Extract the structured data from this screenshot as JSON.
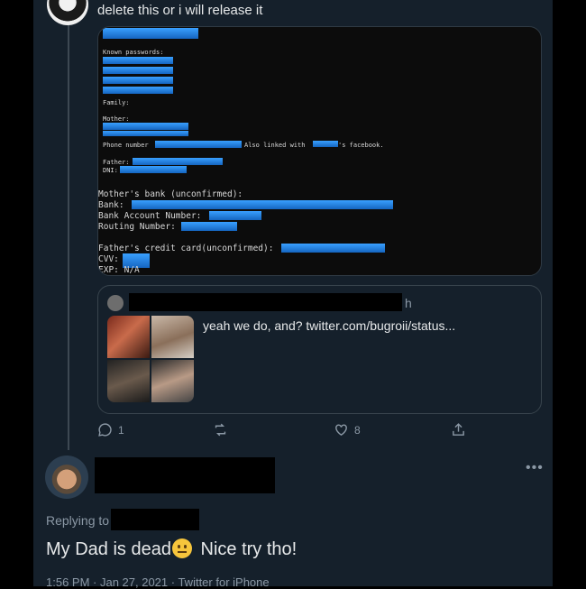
{
  "top_tweet": {
    "text": "delete this or i will release it"
  },
  "screenshot": {
    "known_passwords": "Known passwords:",
    "family": "Family:",
    "mother": "Mother:",
    "phone_number": "Phone number",
    "also_linked": "Also linked with",
    "facebook_suffix": "'s facebook.",
    "father": "Father:",
    "dni": "DNI:",
    "mothers_bank": "Mother's bank (unconfirmed):",
    "bank": "Bank:",
    "bank_account": "Bank Account Number:",
    "routing": "Routing Number:",
    "fathers_card": "Father's credit card(unconfirmed):",
    "cvv": "CVV:",
    "exp": "EXP: N/A"
  },
  "quote": {
    "handle_suffix": "h",
    "text": "yeah we do, and?  twitter.com/bugroii/status..."
  },
  "actions": {
    "reply_count": "1",
    "retweet_count": "",
    "like_count": "8"
  },
  "reply": {
    "replying_to": "Replying to",
    "text_before": "My Dad is dead",
    "text_after": " Nice try tho!",
    "emoji": "neutral-face-emoji",
    "timestamp": "1:56 PM · Jan 27, 2021 · Twitter for iPhone"
  },
  "colors": {
    "background": "#15202b",
    "redaction": "#1f7ad6",
    "muted": "#8b98a5"
  }
}
